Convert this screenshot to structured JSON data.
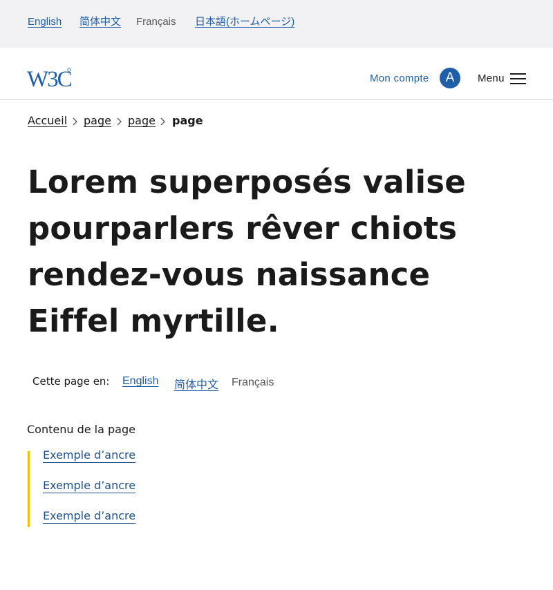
{
  "language_bar": {
    "items": [
      {
        "label": "English",
        "current": false
      },
      {
        "label": "简体中文",
        "current": false
      },
      {
        "label": "Français",
        "current": true
      },
      {
        "label": "日本語(ホームページ)",
        "current": false
      }
    ]
  },
  "header": {
    "logo_text": "W3C",
    "account_label": "Mon compte",
    "avatar_initial": "A",
    "menu_label": "Menu"
  },
  "breadcrumb": {
    "items": [
      "Accueil",
      "page",
      "page"
    ],
    "current": "page"
  },
  "page": {
    "title": "Lorem superposés valise pourparlers rêver chiots rendez-vous naissance Eiffel myrtille."
  },
  "page_languages": {
    "label": "Cette page en:",
    "items": [
      {
        "label": "English",
        "current": false
      },
      {
        "label": "简体中文",
        "current": false
      },
      {
        "label": "Français",
        "current": true
      }
    ]
  },
  "toc": {
    "title": "Contenu de la page",
    "items": [
      "Exemple d’ancre",
      "Exemple d’ancre",
      "Exemple d’ancre"
    ]
  },
  "colors": {
    "link": "#1f5ea8",
    "toc_accent": "#f2c200",
    "language_bar_bg": "#f2f2f4"
  }
}
